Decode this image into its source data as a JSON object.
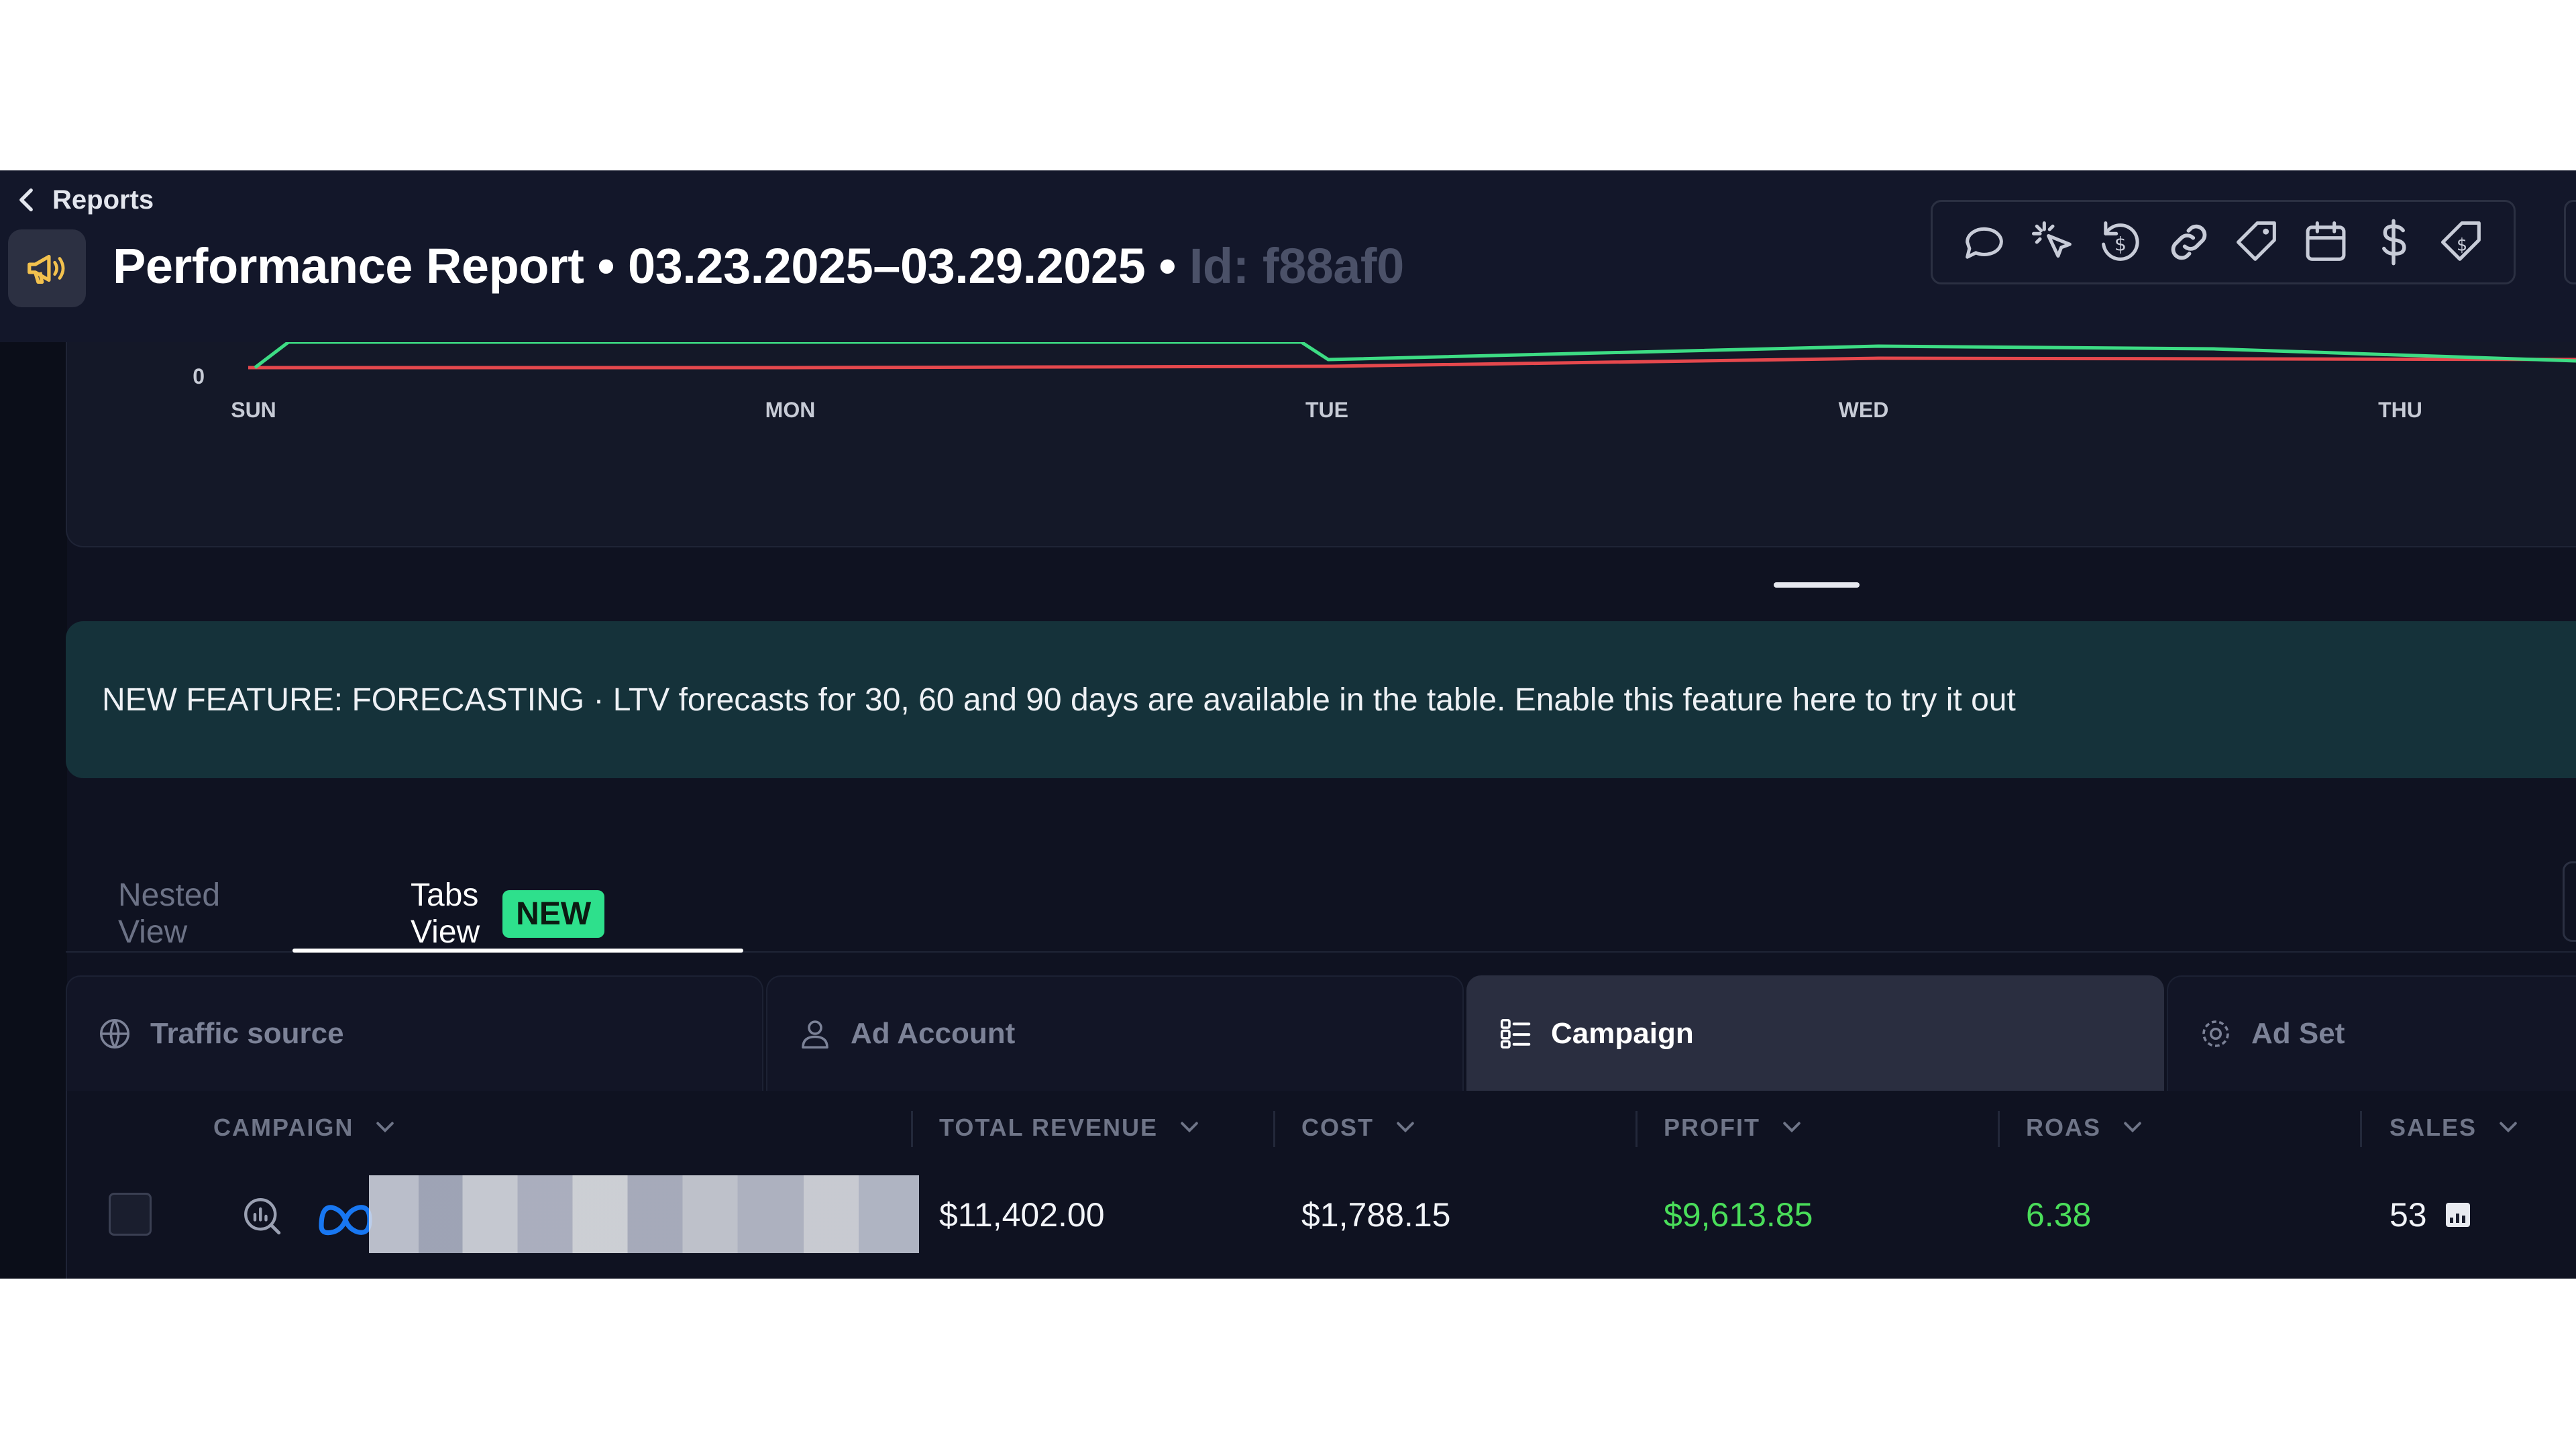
{
  "header": {
    "back_label": "Reports",
    "title_main": "Performance Report • 03.23.2025–03.29.2025 • ",
    "title_id": "Id: f88af0",
    "toolbar_icons": [
      "message-icon",
      "click-icon",
      "refund-icon",
      "link-icon",
      "tag-icon",
      "calendar-icon",
      "dollar-icon",
      "price-tag-icon"
    ]
  },
  "chart": {
    "y_zero_label": "0",
    "x_labels": [
      "SUN",
      "MON",
      "TUE",
      "WED",
      "THU"
    ],
    "colors": {
      "green_series": "#3ddc84",
      "red_series": "#e5484d"
    }
  },
  "banner": {
    "text": "NEW FEATURE: FORECASTING · LTV forecasts for 30, 60 and 90 days are available in the table. Enable this feature here to try it out"
  },
  "view_tabs": {
    "nested": "Nested View",
    "tabs": "Tabs View",
    "new_badge": "NEW"
  },
  "level_tabs": [
    "Traffic source",
    "Ad Account",
    "Campaign",
    "Ad Set"
  ],
  "level_tab_active": "Campaign",
  "table": {
    "columns": [
      "CAMPAIGN",
      "TOTAL REVENUE",
      "COST",
      "PROFIT",
      "ROAS",
      "SALES"
    ],
    "rows": [
      {
        "total_revenue": "$11,402.00",
        "cost": "$1,788.15",
        "profit": "$9,613.85",
        "roas": "6.38",
        "sales": "53"
      }
    ]
  },
  "colors": {
    "background": "#0f1221",
    "accent_green": "#4ade5a",
    "badge_green": "#2ee08c",
    "banner_bg": "#15323a"
  }
}
